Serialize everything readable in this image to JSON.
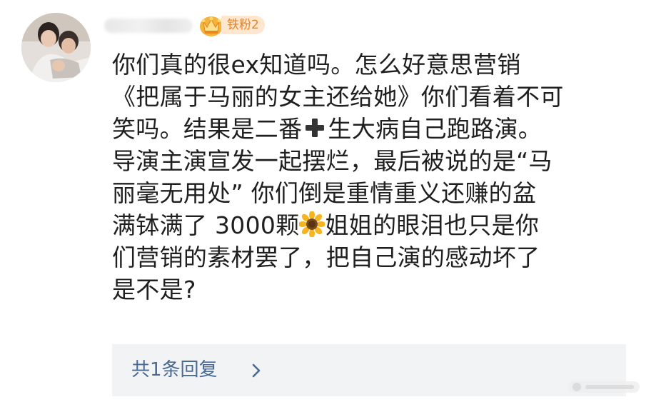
{
  "comment": {
    "badge_label": "铁粉2",
    "lines": [
      "你们真的很ex知道吗。怎么好意思营销",
      "《把属于马丽的女主还给她》你们看着不可",
      "笑吗。结果是二番",
      "生大病自己跑路演。",
      "导演主演宣发一起摆烂，最后被说的是“马",
      "丽毫无用处” 你们倒是重情重义还赚的盆",
      "满钵满了 3000颗",
      "姐姐的眼泪也只是你",
      "们营销的素材罢了，把自己演的感动坏了",
      "是不是?"
    ],
    "icons": {
      "avatar": "user-avatar-photo",
      "badge": "crown-icon",
      "plus": "plus-emoji-icon",
      "sunflower": "sunflower-emoji-icon",
      "chevron": "chevron-right-icon"
    }
  },
  "replies": {
    "summary": "共1条回复"
  },
  "colors": {
    "text": "#1f1f1f",
    "link": "#4a6a96",
    "badge_text": "#e2852b",
    "badge_bg": "#ffe7cf",
    "reply_bg": "#f2f3f5"
  }
}
